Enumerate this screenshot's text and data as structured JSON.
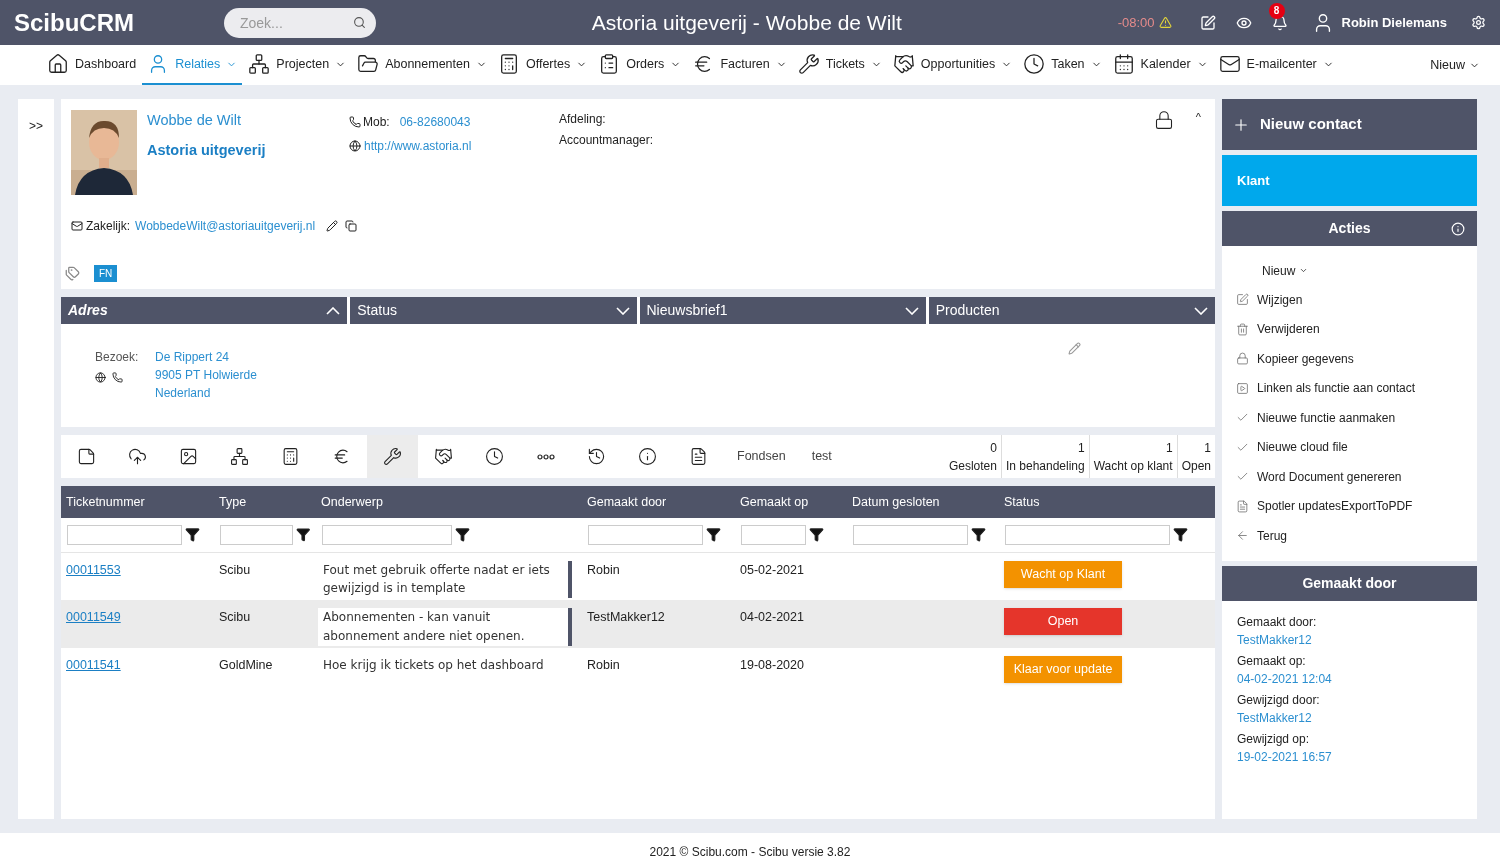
{
  "header": {
    "logo": "ScibuCRM",
    "search": {
      "placeholder": "Zoek..."
    },
    "title": "Astoria uitgeverij - Wobbe de Wilt",
    "time": "-08:00",
    "notifications": "8",
    "user": "Robin Dielemans"
  },
  "nav": {
    "items": [
      {
        "label": "Dashboard",
        "selected": false,
        "dropdown": false
      },
      {
        "label": "Relaties",
        "selected": true,
        "dropdown": true
      },
      {
        "label": "Projecten",
        "selected": false,
        "dropdown": true
      },
      {
        "label": "Abonnementen",
        "selected": false,
        "dropdown": true
      },
      {
        "label": "Offertes",
        "selected": false,
        "dropdown": true
      },
      {
        "label": "Orders",
        "selected": false,
        "dropdown": true
      },
      {
        "label": "Facturen",
        "selected": false,
        "dropdown": true
      },
      {
        "label": "Tickets",
        "selected": false,
        "dropdown": true
      },
      {
        "label": "Opportunities",
        "selected": false,
        "dropdown": true
      },
      {
        "label": "Taken",
        "selected": false,
        "dropdown": true
      },
      {
        "label": "Kalender",
        "selected": false,
        "dropdown": true
      },
      {
        "label": "E-mailcenter",
        "selected": false,
        "dropdown": true
      }
    ],
    "new": "Nieuw"
  },
  "sidebar_toggle": ">>",
  "contact": {
    "name": "Wobbe de Wilt",
    "company": "Astoria uitgeverij",
    "mob_label": "Mob:",
    "mob": "06-82680043",
    "website": "http://www.astoria.nl",
    "fields": [
      "Afdeling:",
      "Accountmanager:"
    ],
    "email_label": "Zakelijk:",
    "email": "WobbedeWilt@astoriauitgeverij.nl",
    "tags": [
      "FN"
    ],
    "collapse": "^"
  },
  "sections": [
    {
      "label": "Adres",
      "expanded": true,
      "selected": true
    },
    {
      "label": "Status",
      "expanded": false,
      "selected": false
    },
    {
      "label": "Nieuwsbrief1",
      "expanded": false,
      "selected": false
    },
    {
      "label": "Producten",
      "expanded": false,
      "selected": false
    }
  ],
  "address": {
    "label": "Bezoek:",
    "lines": [
      "De Rippert 24",
      "9905 PT Holwierde",
      "Nederland"
    ]
  },
  "toolbar": {
    "icons": [
      {
        "selected": false
      },
      {
        "selected": false
      },
      {
        "selected": false
      },
      {
        "selected": false
      },
      {
        "selected": false
      },
      {
        "selected": false
      },
      {
        "selected": true
      },
      {
        "selected": false
      },
      {
        "selected": false
      },
      {
        "selected": false
      },
      {
        "selected": false
      },
      {
        "selected": false
      },
      {
        "selected": false
      }
    ],
    "tabs": [
      "Fondsen",
      "test"
    ],
    "counts": [
      {
        "count": "0",
        "label": "Gesloten"
      },
      {
        "count": "1",
        "label": "In behandeling"
      },
      {
        "count": "1",
        "label": "Wacht op klant"
      },
      {
        "count": "1",
        "label": "Open"
      }
    ]
  },
  "table": {
    "columns": [
      "Ticketnummer",
      "Type",
      "Onderwerp",
      "Gemaakt door",
      "Gemaakt op",
      "Datum gesloten",
      "Status"
    ],
    "rows": [
      {
        "number": "00011553",
        "type": "Scibu",
        "subject": "Fout met gebruik offerte nadat er iets gewijzigd is in template",
        "flag": true,
        "by": "Robin",
        "on": "05-02-2021",
        "status": "Wacht op Klant",
        "color": "#f39200",
        "selected": false
      },
      {
        "number": "00011549",
        "type": "Scibu",
        "subject": "Abonnementen - kan vanuit abonnement andere niet openen.",
        "flag": true,
        "by": "TestMakker12",
        "on": "04-02-2021",
        "status": "Open",
        "color": "#e5352b",
        "selected": true
      },
      {
        "number": "00011541",
        "type": "GoldMine",
        "subject": "Hoe krijg ik tickets op het dashboard",
        "flag": false,
        "by": "Robin",
        "on": "19-08-2020",
        "status": "Klaar voor update",
        "color": "#f39200",
        "selected": false
      }
    ]
  },
  "panel": {
    "new_contact": "Nieuw contact",
    "type": "Klant",
    "actions_title": "Acties",
    "new": "Nieuw",
    "actions": [
      "Wijzigen",
      "Verwijderen",
      "Kopieer gegevens",
      "Linken als functie aan contact",
      "Nieuwe functie aanmaken",
      "Nieuwe cloud file",
      "Word Document genereren",
      "Spotler updatesExportToPDF",
      "Terug"
    ],
    "made_title": "Gemaakt door",
    "made": [
      {
        "label": "Gemaakt door:",
        "value": "TestMakker12"
      },
      {
        "label": "Gemaakt op:",
        "value": "04-02-2021 12:04"
      },
      {
        "label": "Gewijzigd door:",
        "value": "TestMakker12"
      },
      {
        "label": "Gewijzigd op:",
        "value": "19-02-2021 16:57"
      }
    ]
  },
  "footer": "2021 © Scibu.com - Scibu versie 3.82"
}
